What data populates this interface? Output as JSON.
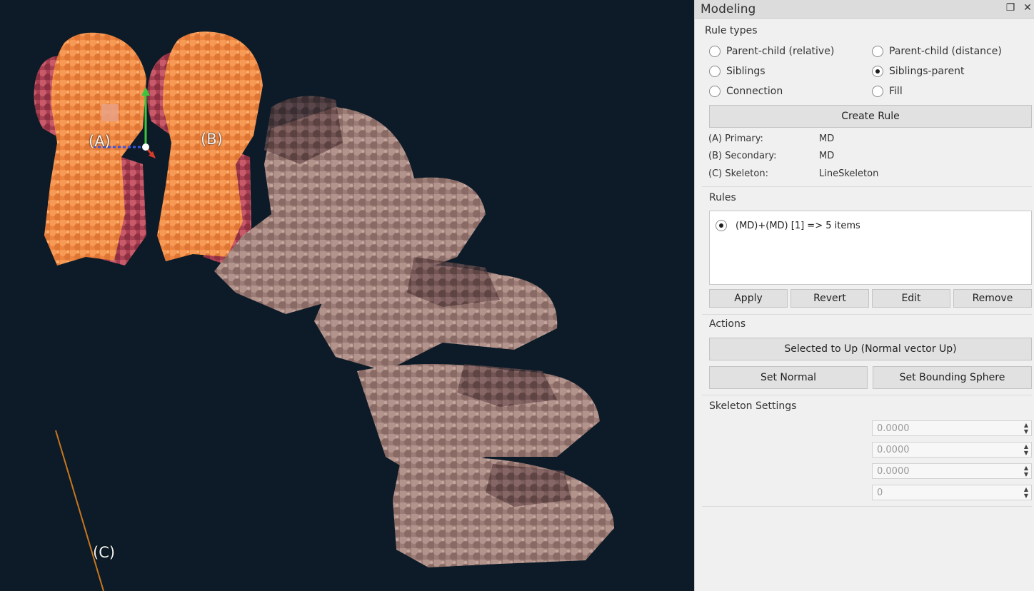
{
  "viewport": {
    "labels": {
      "a": "(A)",
      "b": "(B)",
      "c": "(C)"
    }
  },
  "panel": {
    "title": "Modeling",
    "rule_types": {
      "heading": "Rule types",
      "options": [
        {
          "label": "Parent-child (relative)",
          "selected": false
        },
        {
          "label": "Parent-child (distance)",
          "selected": false
        },
        {
          "label": "Siblings",
          "selected": false
        },
        {
          "label": "Siblings-parent",
          "selected": true
        },
        {
          "label": "Connection",
          "selected": false
        },
        {
          "label": "Fill",
          "selected": false
        }
      ],
      "create_button": "Create Rule"
    },
    "assignments": [
      {
        "key": "(A) Primary:",
        "value": "MD"
      },
      {
        "key": "(B) Secondary:",
        "value": "MD"
      },
      {
        "key": "(C) Skeleton:",
        "value": "LineSkeleton"
      }
    ],
    "rules": {
      "heading": "Rules",
      "items": [
        {
          "label": "(MD)+(MD) [1] => 5 items",
          "selected": true
        }
      ],
      "buttons": {
        "apply": "Apply",
        "revert": "Revert",
        "edit": "Edit",
        "remove": "Remove"
      }
    },
    "actions": {
      "heading": "Actions",
      "selected_up": "Selected to Up (Normal vector Up)",
      "set_normal": "Set Normal",
      "set_bounding": "Set Bounding Sphere"
    },
    "skeleton": {
      "heading": "Skeleton Settings",
      "fields": [
        "0.0000",
        "0.0000",
        "0.0000",
        "0"
      ]
    }
  },
  "colors": {
    "viewport_bg": "#0c1b27",
    "protein_orange": "#f08a45",
    "protein_red": "#b8485a",
    "dna_beige": "#a88780",
    "skeleton_line": "#c8761e"
  }
}
